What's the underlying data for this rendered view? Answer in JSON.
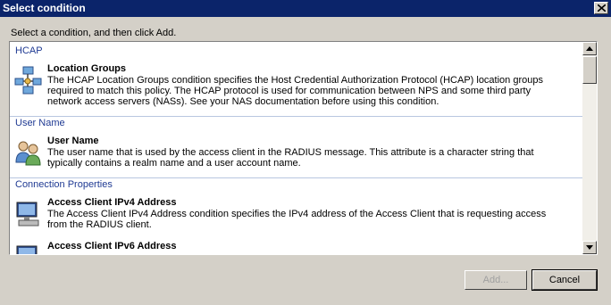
{
  "window": {
    "title": "Select condition"
  },
  "instruction": "Select a condition, and then click Add.",
  "groups": [
    {
      "header": "HCAP",
      "items": [
        {
          "name": "Location Groups",
          "description": "The HCAP Location Groups condition specifies the Host Credential Authorization Protocol (HCAP) location groups required to match this policy. The HCAP protocol is used for communication between NPS and some third party network access servers (NASs). See your NAS documentation before using this condition.",
          "icon": "network-groups-icon"
        }
      ]
    },
    {
      "header": "User Name",
      "items": [
        {
          "name": "User Name",
          "description": "The user name that is used by the access client in the RADIUS message. This attribute is a character string that typically contains a realm name and a user account name.",
          "icon": "users-icon"
        }
      ]
    },
    {
      "header": "Connection Properties",
      "items": [
        {
          "name": "Access Client IPv4 Address",
          "description": "The Access Client IPv4 Address condition specifies the IPv4 address of the Access Client that is requesting access from the RADIUS client.",
          "icon": "computer-icon"
        },
        {
          "name": "Access Client IPv6 Address",
          "description": "",
          "icon": "computer-icon"
        }
      ]
    }
  ],
  "buttons": {
    "add": "Add...",
    "cancel": "Cancel"
  }
}
